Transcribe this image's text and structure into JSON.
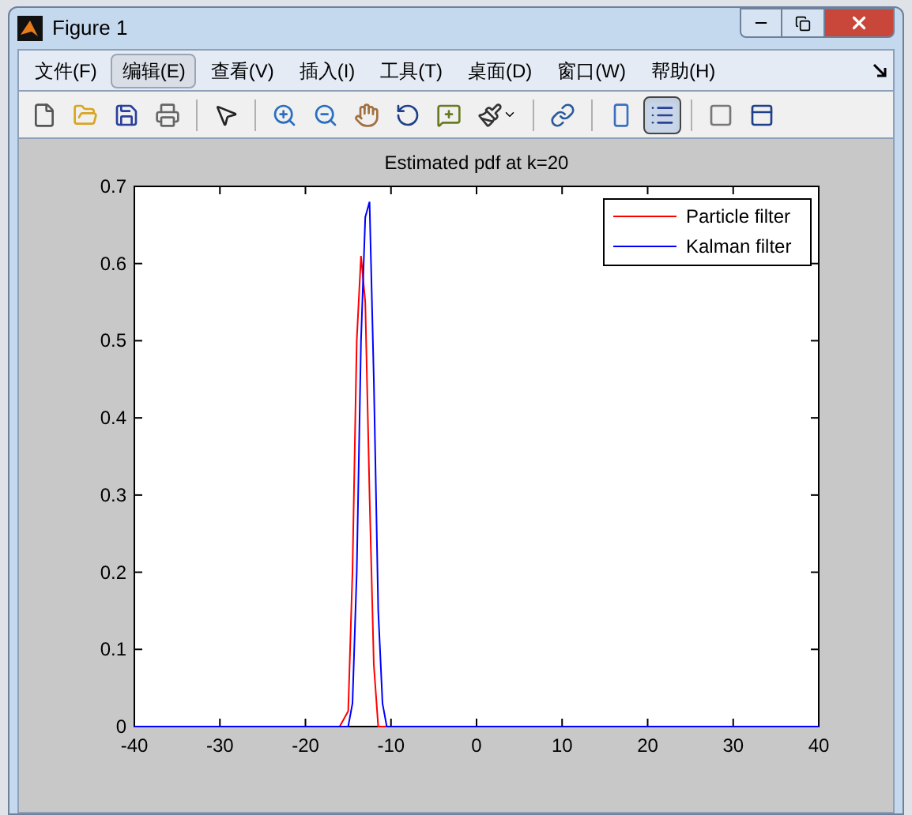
{
  "window": {
    "title": "Figure 1"
  },
  "menu": [
    {
      "label": "文件(F)",
      "selected": false
    },
    {
      "label": "编辑(E)",
      "selected": true
    },
    {
      "label": "查看(V)",
      "selected": false
    },
    {
      "label": "插入(I)",
      "selected": false
    },
    {
      "label": "工具(T)",
      "selected": false
    },
    {
      "label": "桌面(D)",
      "selected": false
    },
    {
      "label": "窗口(W)",
      "selected": false
    },
    {
      "label": "帮助(H)",
      "selected": false
    }
  ],
  "toolbar": [
    {
      "kind": "new",
      "selected": false
    },
    {
      "kind": "open",
      "selected": false
    },
    {
      "kind": "save",
      "selected": false
    },
    {
      "kind": "print",
      "selected": false
    },
    {
      "kind": "separator"
    },
    {
      "kind": "pointer",
      "selected": false
    },
    {
      "kind": "separator"
    },
    {
      "kind": "zoom-in",
      "selected": false
    },
    {
      "kind": "zoom-out",
      "selected": false
    },
    {
      "kind": "pan",
      "selected": false
    },
    {
      "kind": "rotate",
      "selected": false
    },
    {
      "kind": "data-cursor",
      "selected": false
    },
    {
      "kind": "brush",
      "selected": false
    },
    {
      "kind": "separator"
    },
    {
      "kind": "link",
      "selected": false
    },
    {
      "kind": "separator"
    },
    {
      "kind": "colorbar",
      "selected": false
    },
    {
      "kind": "legend",
      "selected": true
    },
    {
      "kind": "separator"
    },
    {
      "kind": "hide-tools",
      "selected": false
    },
    {
      "kind": "show-tools",
      "selected": false
    }
  ],
  "figure": {
    "chart_data": {
      "type": "line",
      "title": "Estimated pdf at k=20",
      "x": [
        -40,
        -18,
        -16,
        -15,
        -14.5,
        -14,
        -13.5,
        -13,
        -12.5,
        -12,
        -11.5,
        -11,
        -10.5,
        -10,
        -8,
        40
      ],
      "series": [
        {
          "name": "Particle filter",
          "color": "#ff0000",
          "values": [
            null,
            0,
            0,
            0.02,
            0.2,
            0.5,
            0.61,
            0.55,
            0.3,
            0.08,
            0,
            0,
            0,
            0,
            0,
            null
          ]
        },
        {
          "name": "Kalman filter",
          "color": "#0000ff",
          "values": [
            0,
            0,
            0,
            0,
            0.03,
            0.2,
            0.5,
            0.66,
            0.68,
            0.45,
            0.15,
            0.03,
            0,
            0,
            0,
            0
          ]
        }
      ],
      "xlim": [
        -40,
        40
      ],
      "ylim": [
        0,
        0.7
      ],
      "xticks": [
        -40,
        -30,
        -20,
        -10,
        0,
        10,
        20,
        30,
        40
      ],
      "yticks": [
        0,
        0.1,
        0.2,
        0.3,
        0.4,
        0.5,
        0.6,
        0.7
      ],
      "legend": true
    }
  }
}
